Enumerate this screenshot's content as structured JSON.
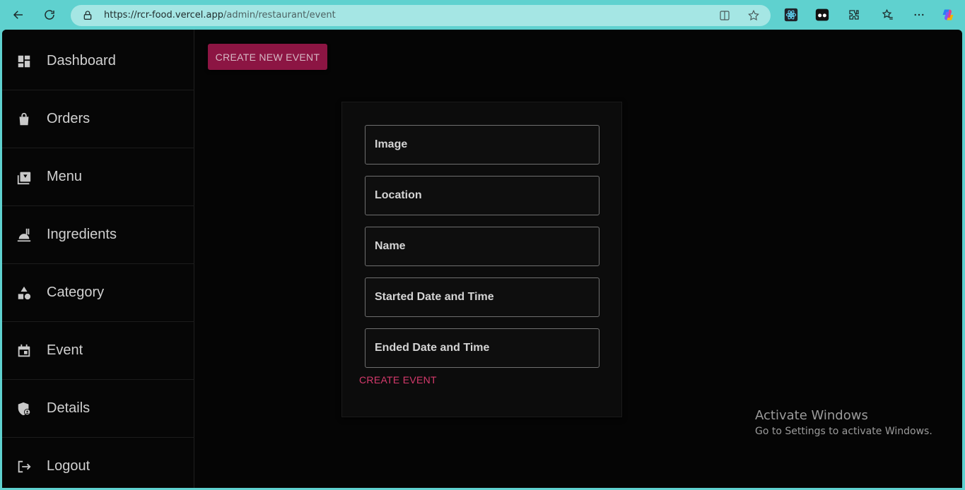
{
  "browser": {
    "url_host": "https://rcr-food.vercel.app",
    "url_path": "/admin/restaurant/event"
  },
  "sidebar": {
    "items": [
      {
        "label": "Dashboard",
        "icon": "dashboard-icon"
      },
      {
        "label": "Orders",
        "icon": "shopping-bag-icon"
      },
      {
        "label": "Menu",
        "icon": "menu-book-icon"
      },
      {
        "label": "Ingredients",
        "icon": "food-bank-icon"
      },
      {
        "label": "Category",
        "icon": "category-icon"
      },
      {
        "label": "Event",
        "icon": "calendar-icon"
      },
      {
        "label": "Details",
        "icon": "admin-shield-icon"
      },
      {
        "label": "Logout",
        "icon": "logout-icon"
      }
    ]
  },
  "main": {
    "create_new_label": "CREATE NEW EVENT",
    "form": {
      "fields": [
        "Image",
        "Location",
        "Name",
        "Started Date and Time",
        "Ended Date and Time"
      ],
      "submit_label": "CREATE EVENT"
    }
  },
  "watermark": {
    "title": "Activate Windows",
    "subtitle": "Go to Settings to activate Windows."
  },
  "colors": {
    "accent": "#8c1543",
    "link": "#d63a6c",
    "chrome": "#5fd1cf"
  }
}
